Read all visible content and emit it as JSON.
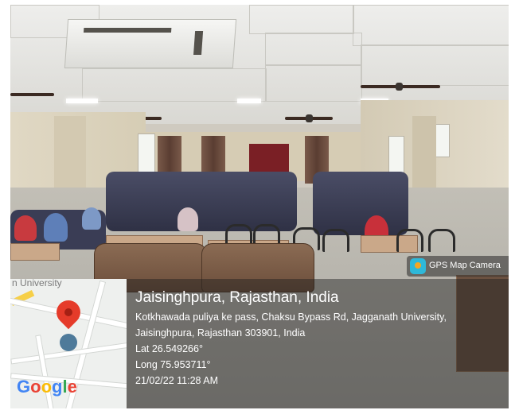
{
  "photo": {
    "description_icon": "classroom-photo"
  },
  "map": {
    "partial_label": "n University",
    "google_logo": [
      "G",
      "o",
      "o",
      "g",
      "l",
      "e"
    ],
    "google_colors": [
      "#4285F4",
      "#EA4335",
      "#FBBC05",
      "#4285F4",
      "#34A853",
      "#EA4335"
    ],
    "pin_color": "#e53b2a"
  },
  "badge": {
    "label": "GPS Map Camera",
    "icon": "gps-map-camera-icon"
  },
  "location": {
    "title": "Jaisinghpura, Rajasthan, India",
    "address_line1": "Kotkhawada puliya ke pass, Chaksu Bypass Rd, Jagganath University,",
    "address_line2": "Jaisinghpura, Rajasthan 303901, India",
    "lat": "Lat 26.549266°",
    "long": "Long 75.953711°",
    "datetime": "21/02/22 11:28 AM"
  }
}
